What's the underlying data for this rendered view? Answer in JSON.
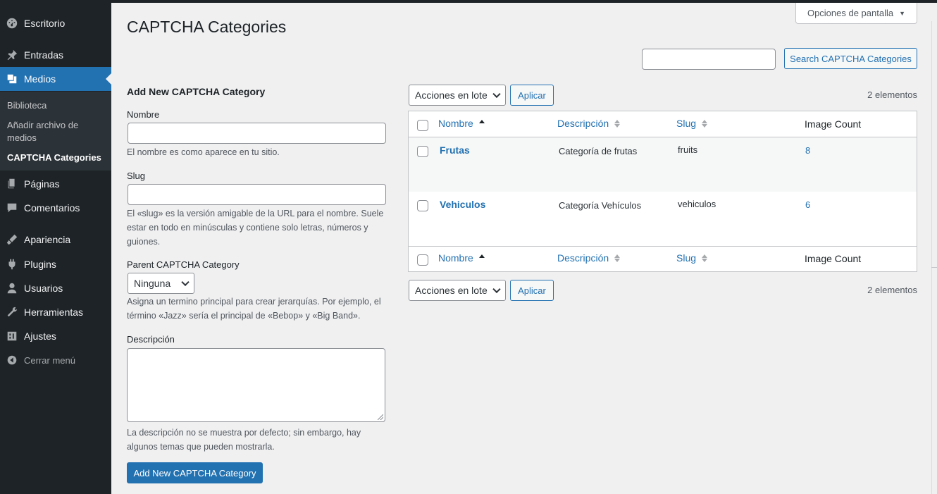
{
  "sidebar": {
    "items": [
      {
        "label": "Escritorio",
        "icon": "dashboard-icon"
      },
      {
        "label": "Entradas",
        "icon": "pin-icon"
      },
      {
        "label": "Medios",
        "icon": "media-icon"
      },
      {
        "label": "Páginas",
        "icon": "pages-icon"
      },
      {
        "label": "Comentarios",
        "icon": "comments-icon"
      },
      {
        "label": "Apariencia",
        "icon": "appearance-icon"
      },
      {
        "label": "Plugins",
        "icon": "plugins-icon"
      },
      {
        "label": "Usuarios",
        "icon": "users-icon"
      },
      {
        "label": "Herramientas",
        "icon": "tools-icon"
      },
      {
        "label": "Ajustes",
        "icon": "settings-icon"
      }
    ],
    "submenu": [
      "Biblioteca",
      "Añadir archivo de medios",
      "CAPTCHA Categories"
    ],
    "collapse_label": "Cerrar menú"
  },
  "screen_options": "Opciones de pantalla",
  "page_title": "CAPTCHA Categories",
  "search": {
    "button": "Search CAPTCHA Categories",
    "value": ""
  },
  "form": {
    "heading": "Add New CAPTCHA Category",
    "name_label": "Nombre",
    "name_help": "El nombre es como aparece en tu sitio.",
    "slug_label": "Slug",
    "slug_help": "El «slug» es la versión amigable de la URL para el nombre. Suele estar en todo en minúsculas y contiene solo letras, números y guiones.",
    "parent_label": "Parent CAPTCHA Category",
    "parent_value": "Ninguna",
    "parent_help": "Asigna un termino principal para crear jerarquías. Por ejemplo, el término «Jazz» sería el principal de «Bebop» y «Big Band».",
    "desc_label": "Descripción",
    "desc_help": "La descripción no se muestra por defecto; sin embargo, hay algunos temas que pueden mostrarla.",
    "submit": "Add New CAPTCHA Category"
  },
  "bulk": {
    "select": "Acciones en lote",
    "apply": "Aplicar",
    "count": "2 elementos"
  },
  "table": {
    "columns": {
      "name": "Nombre",
      "description": "Descripción",
      "slug": "Slug",
      "count": "Image Count"
    },
    "rows": [
      {
        "name": "Frutas",
        "description": "Categoría de frutas",
        "slug": "fruits",
        "count": "8"
      },
      {
        "name": "Vehiculos",
        "description": "Categoría Vehículos",
        "slug": "vehiculos",
        "count": "6"
      }
    ]
  },
  "colors": {
    "sidebar": "#1d2327",
    "accent": "#2271b1",
    "background": "#f0f0f1"
  }
}
